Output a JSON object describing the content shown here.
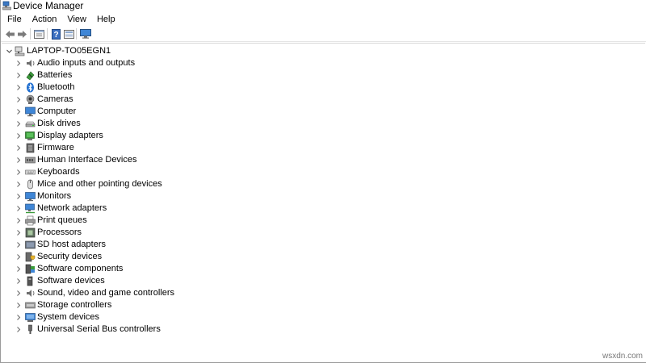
{
  "window": {
    "title": "Device Manager",
    "icon": "device-manager-icon"
  },
  "menu": [
    "File",
    "Action",
    "View",
    "Help"
  ],
  "toolbar": {
    "buttons": [
      "back-arrow-icon",
      "forward-arrow-icon",
      "properties-icon",
      "help-icon",
      "driver-icon",
      "monitor-scan-icon"
    ]
  },
  "tree": {
    "root": {
      "label": "LAPTOP-TO05EGN1",
      "expanded": true,
      "icon": "computer-icon"
    },
    "items": [
      {
        "label": "Audio inputs and outputs",
        "icon": "speaker-icon"
      },
      {
        "label": "Batteries",
        "icon": "battery-icon"
      },
      {
        "label": "Bluetooth",
        "icon": "bluetooth-icon"
      },
      {
        "label": "Cameras",
        "icon": "camera-icon"
      },
      {
        "label": "Computer",
        "icon": "computer-icon"
      },
      {
        "label": "Disk drives",
        "icon": "disk-drive-icon"
      },
      {
        "label": "Display adapters",
        "icon": "display-adapter-icon"
      },
      {
        "label": "Firmware",
        "icon": "firmware-icon"
      },
      {
        "label": "Human Interface Devices",
        "icon": "hid-icon"
      },
      {
        "label": "Keyboards",
        "icon": "keyboard-icon"
      },
      {
        "label": "Mice and other pointing devices",
        "icon": "mouse-icon"
      },
      {
        "label": "Monitors",
        "icon": "monitor-icon"
      },
      {
        "label": "Network adapters",
        "icon": "network-adapter-icon"
      },
      {
        "label": "Print queues",
        "icon": "printer-icon"
      },
      {
        "label": "Processors",
        "icon": "processor-icon"
      },
      {
        "label": "SD host adapters",
        "icon": "sd-card-icon"
      },
      {
        "label": "Security devices",
        "icon": "security-device-icon"
      },
      {
        "label": "Software components",
        "icon": "software-component-icon"
      },
      {
        "label": "Software devices",
        "icon": "software-device-icon"
      },
      {
        "label": "Sound, video and game controllers",
        "icon": "sound-controller-icon"
      },
      {
        "label": "Storage controllers",
        "icon": "storage-controller-icon"
      },
      {
        "label": "System devices",
        "icon": "system-device-icon"
      },
      {
        "label": "Universal Serial Bus controllers",
        "icon": "usb-icon"
      }
    ]
  },
  "watermark": "wsxdn.com",
  "colors": {
    "accent": "#2f79c9",
    "separator": "#d0d0d0",
    "text": "#000000"
  }
}
